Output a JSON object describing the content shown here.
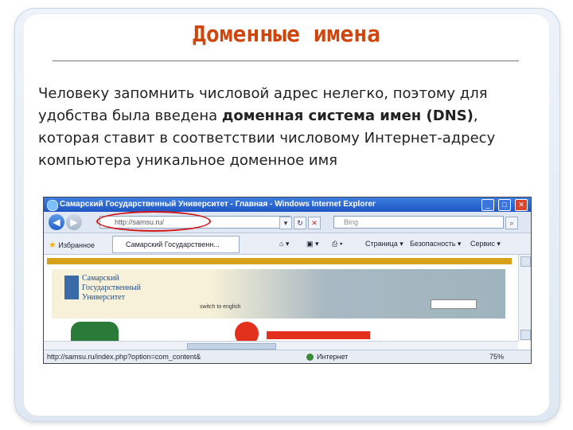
{
  "slide": {
    "title": "Доменные имена",
    "text_before": "Человеку запомнить числовой адрес нелегко, поэтому для удобства была введена ",
    "text_bold": "доменная система имен (DNS)",
    "text_after": ", которая ставит в соответствии числовому Интернет-адресу компьютера уникальное доменное имя"
  },
  "browser": {
    "window_title": "Самарский Государственный Университет - Главная - Windows Internet Explorer",
    "address": "http://samsu.ru/",
    "search_placeholder": "Bing",
    "favorites_label": "Избранное",
    "tab_label": "Самарский Государственн...",
    "toolbar": {
      "page": "Страница",
      "safety": "Безопасность",
      "service": "Сервис"
    },
    "site": {
      "logo_text": "Самарский\nГосударственный\nУниверситет",
      "english_link": "switch to english"
    },
    "status": {
      "url": "http://samsu.ru/index.php?option=com_content&",
      "zone": "Интернет",
      "zoom": "75%"
    }
  },
  "colors": {
    "title": "#d0450c",
    "titlebar": "#1f55c3",
    "highlight_oval": "#d01818"
  }
}
